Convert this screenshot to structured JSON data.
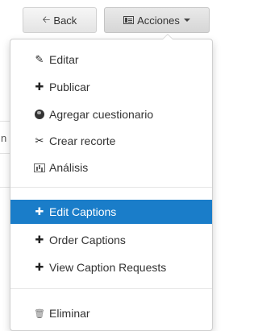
{
  "toolbar": {
    "back_icon": "arrow-left-icon",
    "back_label": "Back",
    "actions_icon": "table-icon",
    "actions_label": "Acciones",
    "actions_caret": "caret-down-icon"
  },
  "background": {
    "partial_char": "n"
  },
  "menu": {
    "items": [
      {
        "icon": "pencil-icon",
        "glyph": "✎",
        "label": "Editar"
      },
      {
        "icon": "plus-icon",
        "glyph": "✚",
        "label": "Publicar"
      },
      {
        "icon": "globe-icon",
        "glyph": "",
        "label": "Agregar cuestionario"
      },
      {
        "icon": "scissors-icon",
        "glyph": "✂",
        "label": "Crear recorte"
      },
      {
        "icon": "chart-icon",
        "glyph": "",
        "label": "Análisis"
      },
      {
        "icon": "plus-icon",
        "glyph": "✚",
        "label": "Edit Captions"
      },
      {
        "icon": "plus-icon",
        "glyph": "✚",
        "label": "Order Captions"
      },
      {
        "icon": "plus-icon",
        "glyph": "✚",
        "label": "View Caption Requests"
      },
      {
        "icon": "trash-icon",
        "glyph": "🗑",
        "label": "Eliminar"
      }
    ],
    "active_item": "Edit Captions",
    "active_color": "#1a7dc9"
  }
}
